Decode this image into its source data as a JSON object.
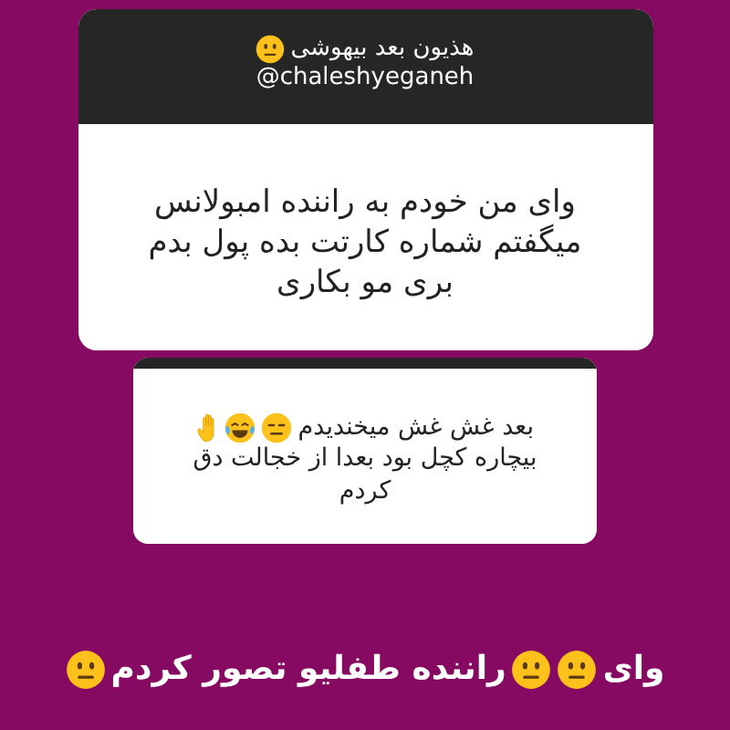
{
  "question_card": {
    "title": [
      {
        "kind": "text",
        "text": "هذیون بعد بیهوشی"
      },
      {
        "kind": "neutral-face"
      }
    ],
    "username": "@chaleshyeganeh",
    "answer_lines": [
      "وای من خودم به راننده امبولانس",
      "میگفتم شماره کارتت بده پول بدم",
      "بری مو بکاری"
    ]
  },
  "reply_card": {
    "lines": [
      [
        {
          "kind": "text",
          "text": "بعد غش غش میخندیدم"
        },
        {
          "kind": "expressionless-face"
        },
        {
          "kind": "laughing-face"
        },
        {
          "kind": "raised-hand"
        }
      ],
      [
        {
          "kind": "text",
          "text": "بیچاره کچل بود  بعدا از خجالت دق"
        }
      ],
      [
        {
          "kind": "text",
          "text": "کردم"
        }
      ]
    ]
  },
  "caption": [
    {
      "kind": "text",
      "text": "وای"
    },
    {
      "kind": "neutral-face"
    },
    {
      "kind": "neutral-face"
    },
    {
      "kind": "text",
      "text": "راننده طفلیو تصور کردم"
    },
    {
      "kind": "neutral-face"
    }
  ]
}
